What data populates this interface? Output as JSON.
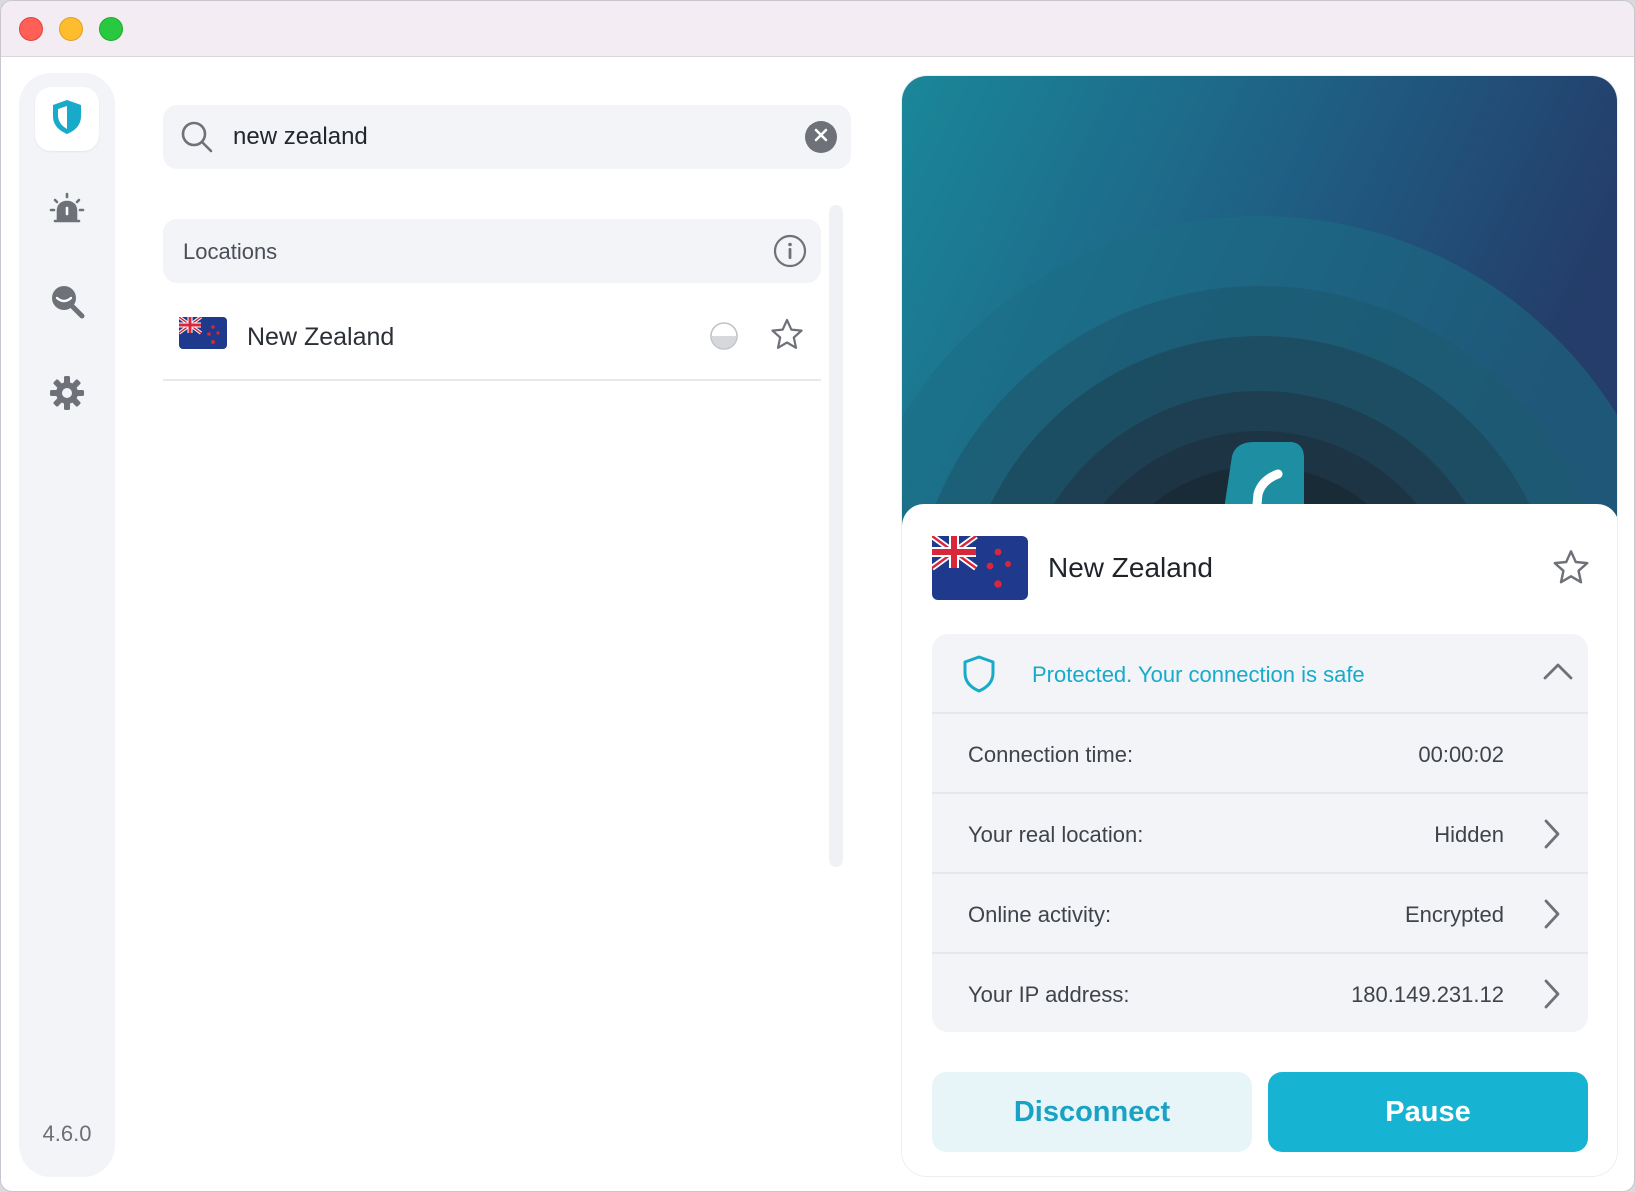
{
  "window": {
    "controls": [
      "close",
      "minimize",
      "zoom"
    ]
  },
  "sidebar": {
    "items": [
      {
        "icon": "shield-icon",
        "active": true
      },
      {
        "icon": "alert-siren-icon",
        "active": false
      },
      {
        "icon": "search-eye-icon",
        "active": false
      },
      {
        "icon": "gear-icon",
        "active": false
      }
    ],
    "version": "4.6.0"
  },
  "search": {
    "value": "new zealand",
    "placeholder": ""
  },
  "locations": {
    "header": "Locations",
    "items": [
      {
        "name": "New Zealand",
        "flag": "nz-flag-icon",
        "load_icon": "server-load-icon",
        "favorite": false
      }
    ]
  },
  "connection": {
    "country": "New Zealand",
    "status": "Protected. Your connection is safe",
    "rows": [
      {
        "label": "Connection time:",
        "value": "00:00:02",
        "expandable": false
      },
      {
        "label": "Your real location:",
        "value": "Hidden",
        "expandable": true
      },
      {
        "label": "Online activity:",
        "value": "Encrypted",
        "expandable": true
      },
      {
        "label": "Your IP address:",
        "value": "180.149.231.12",
        "expandable": true
      }
    ],
    "disconnect_label": "Disconnect",
    "pause_label": "Pause"
  },
  "colors": {
    "accent": "#17b3d2",
    "accent_light": "#e7f5f9",
    "status_text": "#17aacb",
    "hero_dark": "#1c2e3a",
    "hero_teal": "#1a7f95",
    "hero_navy": "#243d6a"
  }
}
